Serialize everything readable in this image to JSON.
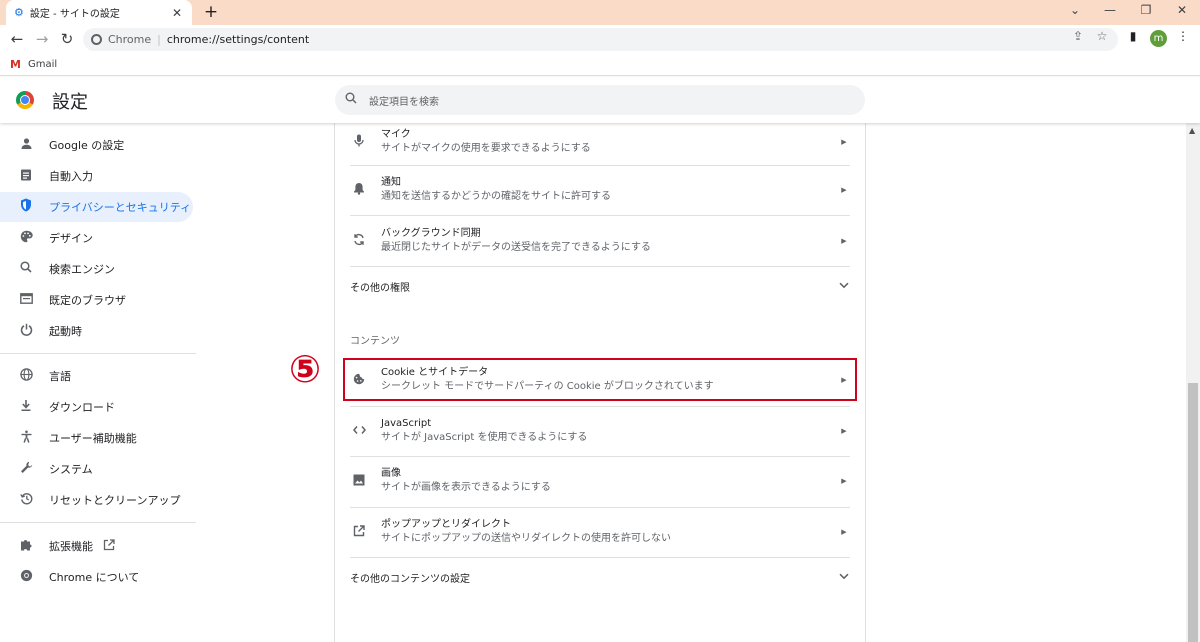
{
  "tab": {
    "title": "設定 - サイトの設定",
    "icon": "gear-icon"
  },
  "window": {
    "newtab_icon": "+",
    "dropdown_icon": "⌄",
    "minimize_icon": "—",
    "restore_icon": "❐",
    "close_icon": "✕"
  },
  "toolbar": {
    "back_icon": "←",
    "forward_icon": "→",
    "reload_icon": "↻",
    "origin": "Chrome",
    "separator": "|",
    "url": "chrome://settings/content",
    "share_icon": "⇪",
    "star_icon": "☆",
    "sidepanel_icon": "▮",
    "menu_icon": "⋮",
    "profile_initial": "m"
  },
  "bookmarks": [
    {
      "label": "Gmail",
      "icon": "M"
    }
  ],
  "header": {
    "title": "設定",
    "search_placeholder": "設定項目を検索"
  },
  "sidebar": {
    "items": [
      {
        "label": "Google の設定",
        "icon": "person-icon",
        "glyph": "👤"
      },
      {
        "label": "自動入力",
        "icon": "clipboard-icon",
        "glyph": "📋"
      },
      {
        "label": "プライバシーとセキュリティ",
        "icon": "shield-icon",
        "glyph": "🛡"
      },
      {
        "label": "デザイン",
        "icon": "palette-icon",
        "glyph": "🎨"
      },
      {
        "label": "検索エンジン",
        "icon": "search-icon",
        "glyph": "🔍"
      },
      {
        "label": "既定のブラウザ",
        "icon": "browser-icon",
        "glyph": "▭"
      },
      {
        "label": "起動時",
        "icon": "power-icon",
        "glyph": "⏻"
      },
      {
        "label": "言語",
        "icon": "globe-icon",
        "glyph": "🌐"
      },
      {
        "label": "ダウンロード",
        "icon": "download-icon",
        "glyph": "⬇"
      },
      {
        "label": "ユーザー補助機能",
        "icon": "accessibility-icon",
        "glyph": "♿"
      },
      {
        "label": "システム",
        "icon": "wrench-icon",
        "glyph": "🔧"
      },
      {
        "label": "リセットとクリーンアップ",
        "icon": "history-icon",
        "glyph": "⟲"
      },
      {
        "label": "拡張機能",
        "icon": "puzzle-icon",
        "glyph": "🧩",
        "external_icon": "↗"
      },
      {
        "label": "Chrome について",
        "icon": "chrome-icon",
        "glyph": "◎"
      }
    ],
    "active_index": 2
  },
  "main": {
    "rows": [
      {
        "title": "マイク",
        "subtitle": "サイトがマイクの使用を要求できるようにする",
        "icon": "microphone-icon",
        "glyph": "🎤"
      },
      {
        "title": "通知",
        "subtitle": "通知を送信するかどうかの確認をサイトに許可する",
        "icon": "bell-icon",
        "glyph": "🔔"
      },
      {
        "title": "バックグラウンド同期",
        "subtitle": "最近閉じたサイトがデータの送受信を完了できるようにする",
        "icon": "sync-icon",
        "glyph": "⟳"
      }
    ],
    "more_permissions": "その他の権限",
    "content_section": "コンテンツ",
    "content_rows": [
      {
        "title": "Cookie とサイトデータ",
        "subtitle": "シークレット モードでサードパーティの Cookie がブロックされています",
        "icon": "cookie-icon",
        "glyph": "🍪"
      },
      {
        "title": "JavaScript",
        "subtitle": "サイトが JavaScript を使用できるようにする",
        "icon": "code-icon",
        "glyph": "<>"
      },
      {
        "title": "画像",
        "subtitle": "サイトが画像を表示できるようにする",
        "icon": "image-icon",
        "glyph": "🖼"
      },
      {
        "title": "ポップアップとリダイレクト",
        "subtitle": "サイトにポップアップの送信やリダイレクトの使用を許可しない",
        "icon": "open-in-new-icon",
        "glyph": "↗"
      }
    ],
    "more_content": "その他のコンテンツの設定",
    "arrow": "▶",
    "chevron": "⌄"
  },
  "annotation": {
    "label": "⑤",
    "color": "#d0021b"
  },
  "colors": {
    "accent": "#1a73e8",
    "tabstrip": "#fadbc7",
    "highlight": "#d0021b"
  }
}
